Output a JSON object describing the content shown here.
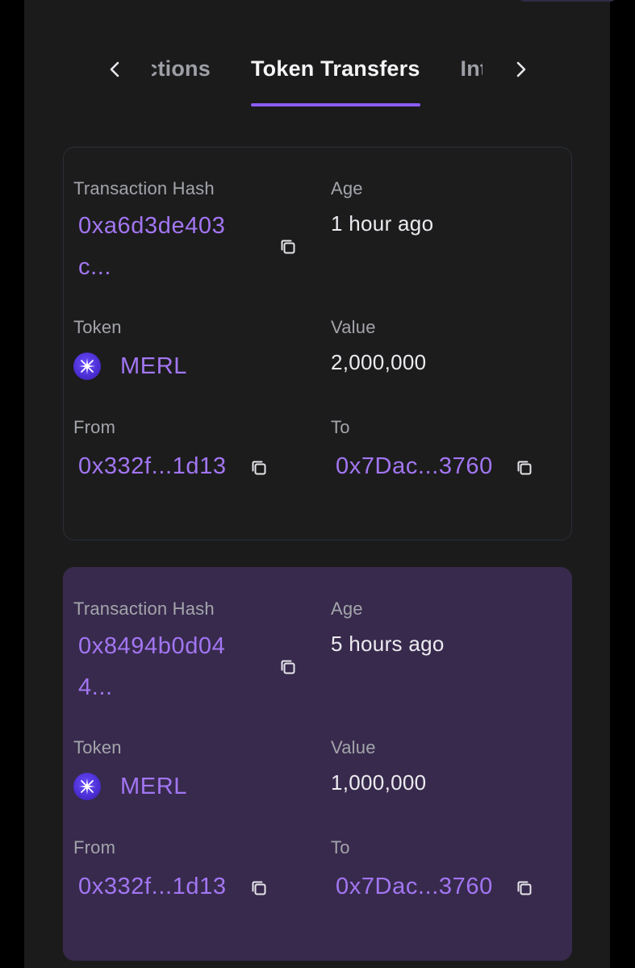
{
  "tabs": {
    "items": [
      {
        "label": "Transactions",
        "active": false
      },
      {
        "label": "Token Transfers",
        "active": true
      },
      {
        "label": "Internal Txns",
        "active": false
      }
    ],
    "prev_icon": "chevron-left-icon",
    "next_icon": "chevron-right-icon"
  },
  "labels": {
    "hash": "Transaction Hash",
    "age": "Age",
    "token": "Token",
    "value": "Value",
    "from": "From",
    "to": "To"
  },
  "transfers": [
    {
      "hash": "0xa6d3de403c...",
      "age": "1 hour ago",
      "token": "MERL",
      "value": "2,000,000",
      "from": "0x332f...1d13",
      "to": "0x7Dac...3760",
      "highlighted": false
    },
    {
      "hash": "0x8494b0d044...",
      "age": "5 hours ago",
      "token": "MERL",
      "value": "1,000,000",
      "from": "0x332f...1d13",
      "to": "0x7Dac...3760",
      "highlighted": true
    }
  ],
  "colors": {
    "accent": "#8b5cf6",
    "link": "#a276f2",
    "highlight_card": "#382a4d"
  }
}
